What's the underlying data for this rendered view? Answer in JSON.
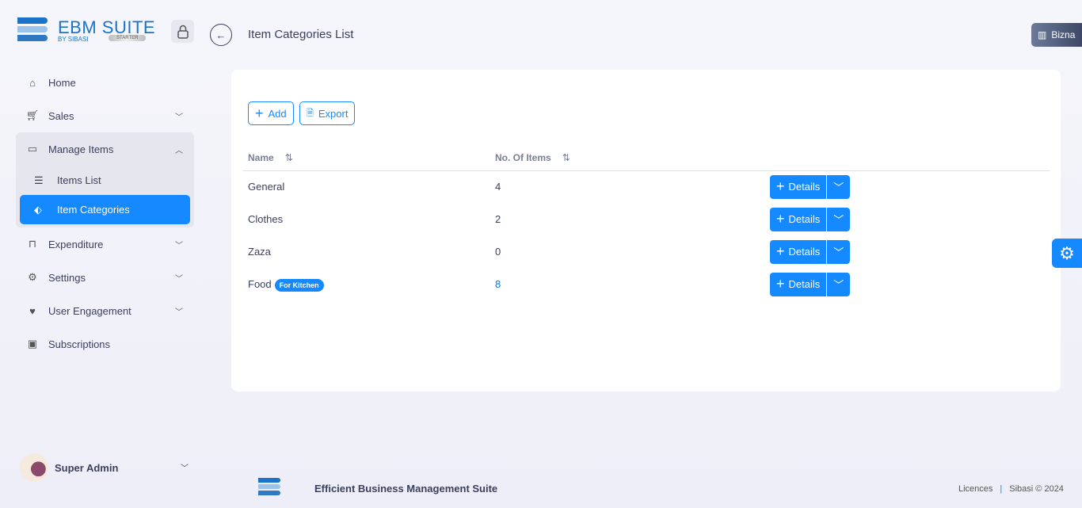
{
  "brand": {
    "name": "EBM SUITE",
    "by": "BY SIBASI",
    "plan": "STARTER"
  },
  "header": {
    "title": "Item Categories List",
    "business": "Bizna"
  },
  "sidebar": {
    "items": [
      {
        "label": "Home",
        "icon": "home-icon"
      },
      {
        "label": "Sales",
        "icon": "cart-icon"
      },
      {
        "label": "Manage Items",
        "icon": "briefcase-icon",
        "expanded": true,
        "children": [
          {
            "label": "Items List",
            "icon": "list-icon"
          },
          {
            "label": "Item Categories",
            "icon": "tag-icon",
            "active": true
          }
        ]
      },
      {
        "label": "Expenditure",
        "icon": "bag-icon"
      },
      {
        "label": "Settings",
        "icon": "gear-icon"
      },
      {
        "label": "User Engagement",
        "icon": "heart-icon"
      },
      {
        "label": "Subscriptions",
        "icon": "money-icon"
      }
    ]
  },
  "user": {
    "name": "Super Admin"
  },
  "toolbar": {
    "add": "Add",
    "export": "Export"
  },
  "table": {
    "columns": [
      "Name",
      "No. Of Items"
    ],
    "details_label": "Details",
    "rows": [
      {
        "name": "General",
        "count": "4",
        "badge": ""
      },
      {
        "name": "Clothes",
        "count": "2",
        "badge": ""
      },
      {
        "name": "Zaza",
        "count": "0",
        "badge": ""
      },
      {
        "name": "Food",
        "count": "8",
        "badge": "For Kitchen"
      }
    ]
  },
  "footer": {
    "text": "Efficient Business Management Suite",
    "licences": "Licences",
    "copyright": "Sibasi © 2024"
  },
  "colors": {
    "accent": "#1589ff",
    "brand": "#1a73c9"
  }
}
